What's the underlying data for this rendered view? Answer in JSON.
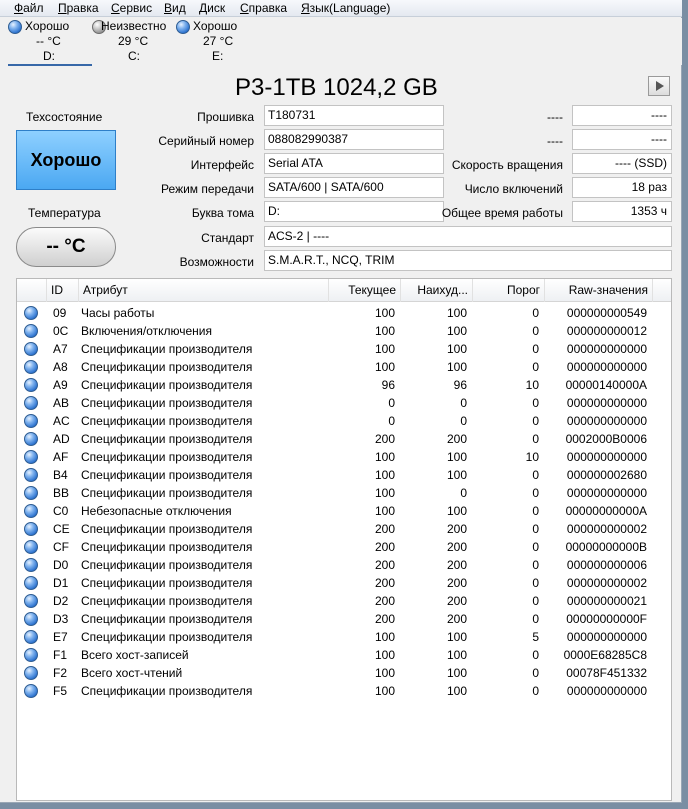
{
  "menu": [
    "Файл",
    "Правка",
    "Сервис",
    "Вид",
    "Диск",
    "Справка",
    "Язык(Language)"
  ],
  "disks": [
    {
      "status": "Хорошо",
      "temp": "-- °C",
      "letter": "D:",
      "indicator": "good",
      "color": "#2c72cf"
    },
    {
      "status": "Неизвестно",
      "temp": "29 °C",
      "letter": "C:",
      "indicator": "unknown",
      "color": "#8a8a8a"
    },
    {
      "status": "Хорошо",
      "temp": "27 °C",
      "letter": "E:",
      "indicator": "good",
      "color": "#2c72cf"
    }
  ],
  "model": "P3-1TB 1024,2 GB",
  "health": {
    "title": "Техсостояние",
    "value": "Хорошо",
    "color": "#4ba8f2"
  },
  "temperature": {
    "title": "Температура",
    "value": "-- °C"
  },
  "info": {
    "firmware": {
      "label": "Прошивка",
      "value": "T180731"
    },
    "serial": {
      "label": "Серийный номер",
      "value": "088082990387"
    },
    "interface": {
      "label": "Интерфейс",
      "value": "Serial ATA"
    },
    "transfer": {
      "label": "Режим передачи",
      "value": "SATA/600 | SATA/600"
    },
    "volume": {
      "label": "Буква тома",
      "value": "D:"
    },
    "standard": {
      "label": "Стандарт",
      "value": "ACS-2 | ----"
    },
    "features": {
      "label": "Возможности",
      "value": "S.M.A.R.T., NCQ, TRIM"
    }
  },
  "right_info": {
    "r1": {
      "label": "----",
      "value": "----"
    },
    "r2": {
      "label": "----",
      "value": "----"
    },
    "rotation": {
      "label": "Скорость вращения",
      "value": "---- (SSD)"
    },
    "power_count": {
      "label": "Число включений",
      "value": "18 раз"
    },
    "power_hours": {
      "label": "Общее время работы",
      "value": "1353 ч"
    }
  },
  "table": {
    "headers": {
      "id": "ID",
      "attr": "Атрибут",
      "cur": "Текущее",
      "worst": "Наихуд...",
      "thresh": "Порог",
      "raw": "Raw-значения"
    },
    "rows": [
      {
        "id": "09",
        "name": "Часы работы",
        "cur": "100",
        "worst": "100",
        "thresh": "0",
        "raw": "000000000549"
      },
      {
        "id": "0C",
        "name": "Включения/отключения",
        "cur": "100",
        "worst": "100",
        "thresh": "0",
        "raw": "000000000012"
      },
      {
        "id": "A7",
        "name": "Спецификации производителя",
        "cur": "100",
        "worst": "100",
        "thresh": "0",
        "raw": "000000000000"
      },
      {
        "id": "A8",
        "name": "Спецификации производителя",
        "cur": "100",
        "worst": "100",
        "thresh": "0",
        "raw": "000000000000"
      },
      {
        "id": "A9",
        "name": "Спецификации производителя",
        "cur": "96",
        "worst": "96",
        "thresh": "10",
        "raw": "00000140000A"
      },
      {
        "id": "AB",
        "name": "Спецификации производителя",
        "cur": "0",
        "worst": "0",
        "thresh": "0",
        "raw": "000000000000"
      },
      {
        "id": "AC",
        "name": "Спецификации производителя",
        "cur": "0",
        "worst": "0",
        "thresh": "0",
        "raw": "000000000000"
      },
      {
        "id": "AD",
        "name": "Спецификации производителя",
        "cur": "200",
        "worst": "200",
        "thresh": "0",
        "raw": "0002000B0006"
      },
      {
        "id": "AF",
        "name": "Спецификации производителя",
        "cur": "100",
        "worst": "100",
        "thresh": "10",
        "raw": "000000000000"
      },
      {
        "id": "B4",
        "name": "Спецификации производителя",
        "cur": "100",
        "worst": "100",
        "thresh": "0",
        "raw": "000000002680"
      },
      {
        "id": "BB",
        "name": "Спецификации производителя",
        "cur": "100",
        "worst": "0",
        "thresh": "0",
        "raw": "000000000000"
      },
      {
        "id": "C0",
        "name": "Небезопасные отключения",
        "cur": "100",
        "worst": "100",
        "thresh": "0",
        "raw": "00000000000A"
      },
      {
        "id": "CE",
        "name": "Спецификации производителя",
        "cur": "200",
        "worst": "200",
        "thresh": "0",
        "raw": "000000000002"
      },
      {
        "id": "CF",
        "name": "Спецификации производителя",
        "cur": "200",
        "worst": "200",
        "thresh": "0",
        "raw": "00000000000B"
      },
      {
        "id": "D0",
        "name": "Спецификации производителя",
        "cur": "200",
        "worst": "200",
        "thresh": "0",
        "raw": "000000000006"
      },
      {
        "id": "D1",
        "name": "Спецификации производителя",
        "cur": "200",
        "worst": "200",
        "thresh": "0",
        "raw": "000000000002"
      },
      {
        "id": "D2",
        "name": "Спецификации производителя",
        "cur": "200",
        "worst": "200",
        "thresh": "0",
        "raw": "000000000021"
      },
      {
        "id": "D3",
        "name": "Спецификации производителя",
        "cur": "200",
        "worst": "200",
        "thresh": "0",
        "raw": "00000000000F"
      },
      {
        "id": "E7",
        "name": "Спецификации производителя",
        "cur": "100",
        "worst": "100",
        "thresh": "5",
        "raw": "000000000000"
      },
      {
        "id": "F1",
        "name": "Всего хост-записей",
        "cur": "100",
        "worst": "100",
        "thresh": "0",
        "raw": "0000E68285C8"
      },
      {
        "id": "F2",
        "name": "Всего хост-чтений",
        "cur": "100",
        "worst": "100",
        "thresh": "0",
        "raw": "00078F451332"
      },
      {
        "id": "F5",
        "name": "Спецификации производителя",
        "cur": "100",
        "worst": "100",
        "thresh": "0",
        "raw": "000000000000"
      }
    ]
  }
}
